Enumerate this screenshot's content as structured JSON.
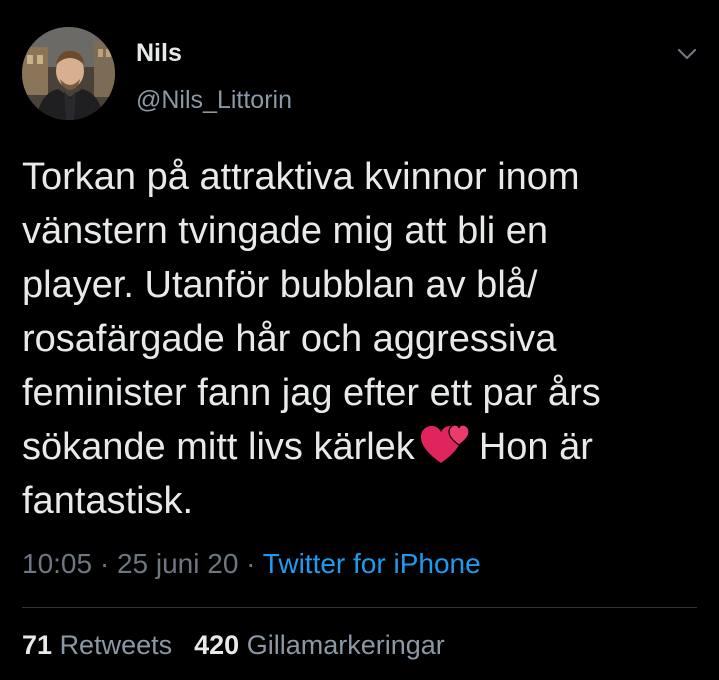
{
  "author": {
    "name": "Nils",
    "handle": "@Nils_Littorin"
  },
  "tweet": {
    "lines": [
      "Torkan på attraktiva kvinnor inom",
      "vänstern tvingade mig att bli en",
      "player. Utanför bubblan av blå/",
      "rosafärgade hår och aggressiva",
      "feminister fann jag efter ett par års",
      "sökande mitt livs kärlek",
      "Hon är",
      "fantastisk."
    ],
    "emoji": "two-hearts"
  },
  "meta": {
    "time": "10:05",
    "separator": " · ",
    "date": "25 juni 20",
    "source": "Twitter for iPhone"
  },
  "stats": {
    "retweets_count": "71",
    "retweets_label": "Retweets",
    "likes_count": "420",
    "likes_label": "Gillamarkeringar"
  },
  "colors": {
    "background": "#000000",
    "text": "#e7e9ea",
    "muted": "#8b98a5",
    "link": "#1d9bf0",
    "divider": "#2f3336",
    "heart": "#e0245e"
  },
  "icons": {
    "menu": "chevron-down-icon",
    "emoji": "two-hearts-icon"
  }
}
